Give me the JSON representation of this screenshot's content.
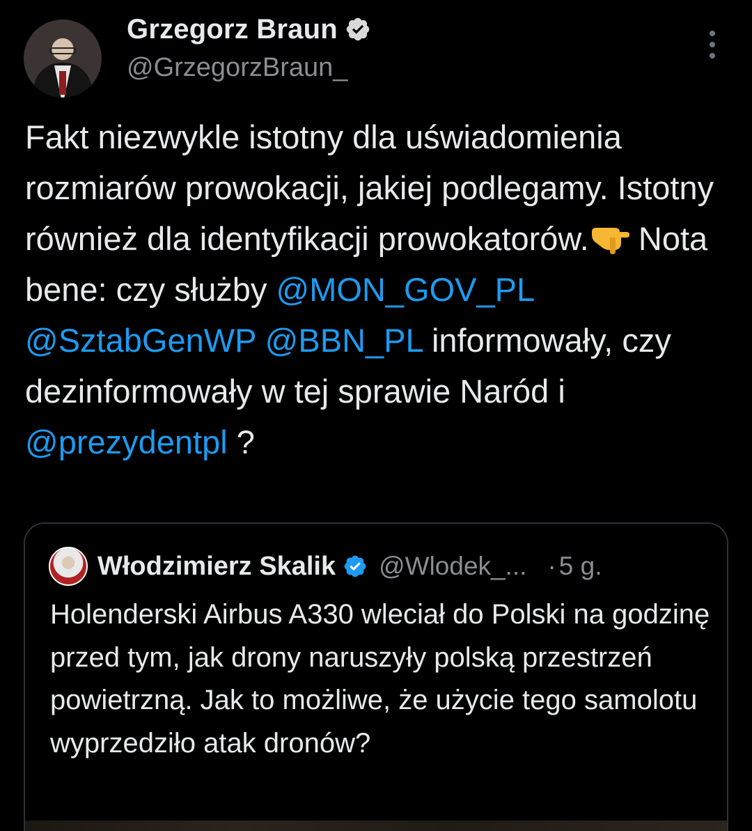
{
  "author": {
    "name": "Grzegorz Braun",
    "handle": "@GrzegorzBraun_",
    "verified": true
  },
  "tweet": {
    "text_1": "Fakt niezwykle istotny dla uświadomienia rozmiarów prowokacji, jakiej podlegamy. Istotny również dla identyfikacji prowokatorów.",
    "emoji": "pointing-down-hand-emoji",
    "text_2": " Nota bene: czy służby ",
    "mention_1": "@MON_GOV_PL",
    "mention_2": "@SztabGenWP",
    "mention_3": "@BBN_PL",
    "text_3": " informowały, czy dezinformowały w tej sprawie Naród i ",
    "mention_4": "@prezydentpl",
    "text_4": " ?"
  },
  "quoted": {
    "name": "Włodzimierz Skalik",
    "handle": "@Wlodek_...",
    "separator": "·",
    "time": "5 g.",
    "verified": true,
    "text": "Holenderski Airbus A330 wleciał do Polski na godzinę przed tym, jak drony naruszyły polską przestrzeń powietrzną. Jak to możliwe, że użycie tego samolotu wyprzedziło atak dronów?"
  },
  "colors": {
    "background": "#000000",
    "text": "#e7e9ea",
    "secondary": "#8b8d91",
    "link": "#1d9bf0",
    "verified": "#1d9bf0",
    "border": "#2f3336"
  }
}
